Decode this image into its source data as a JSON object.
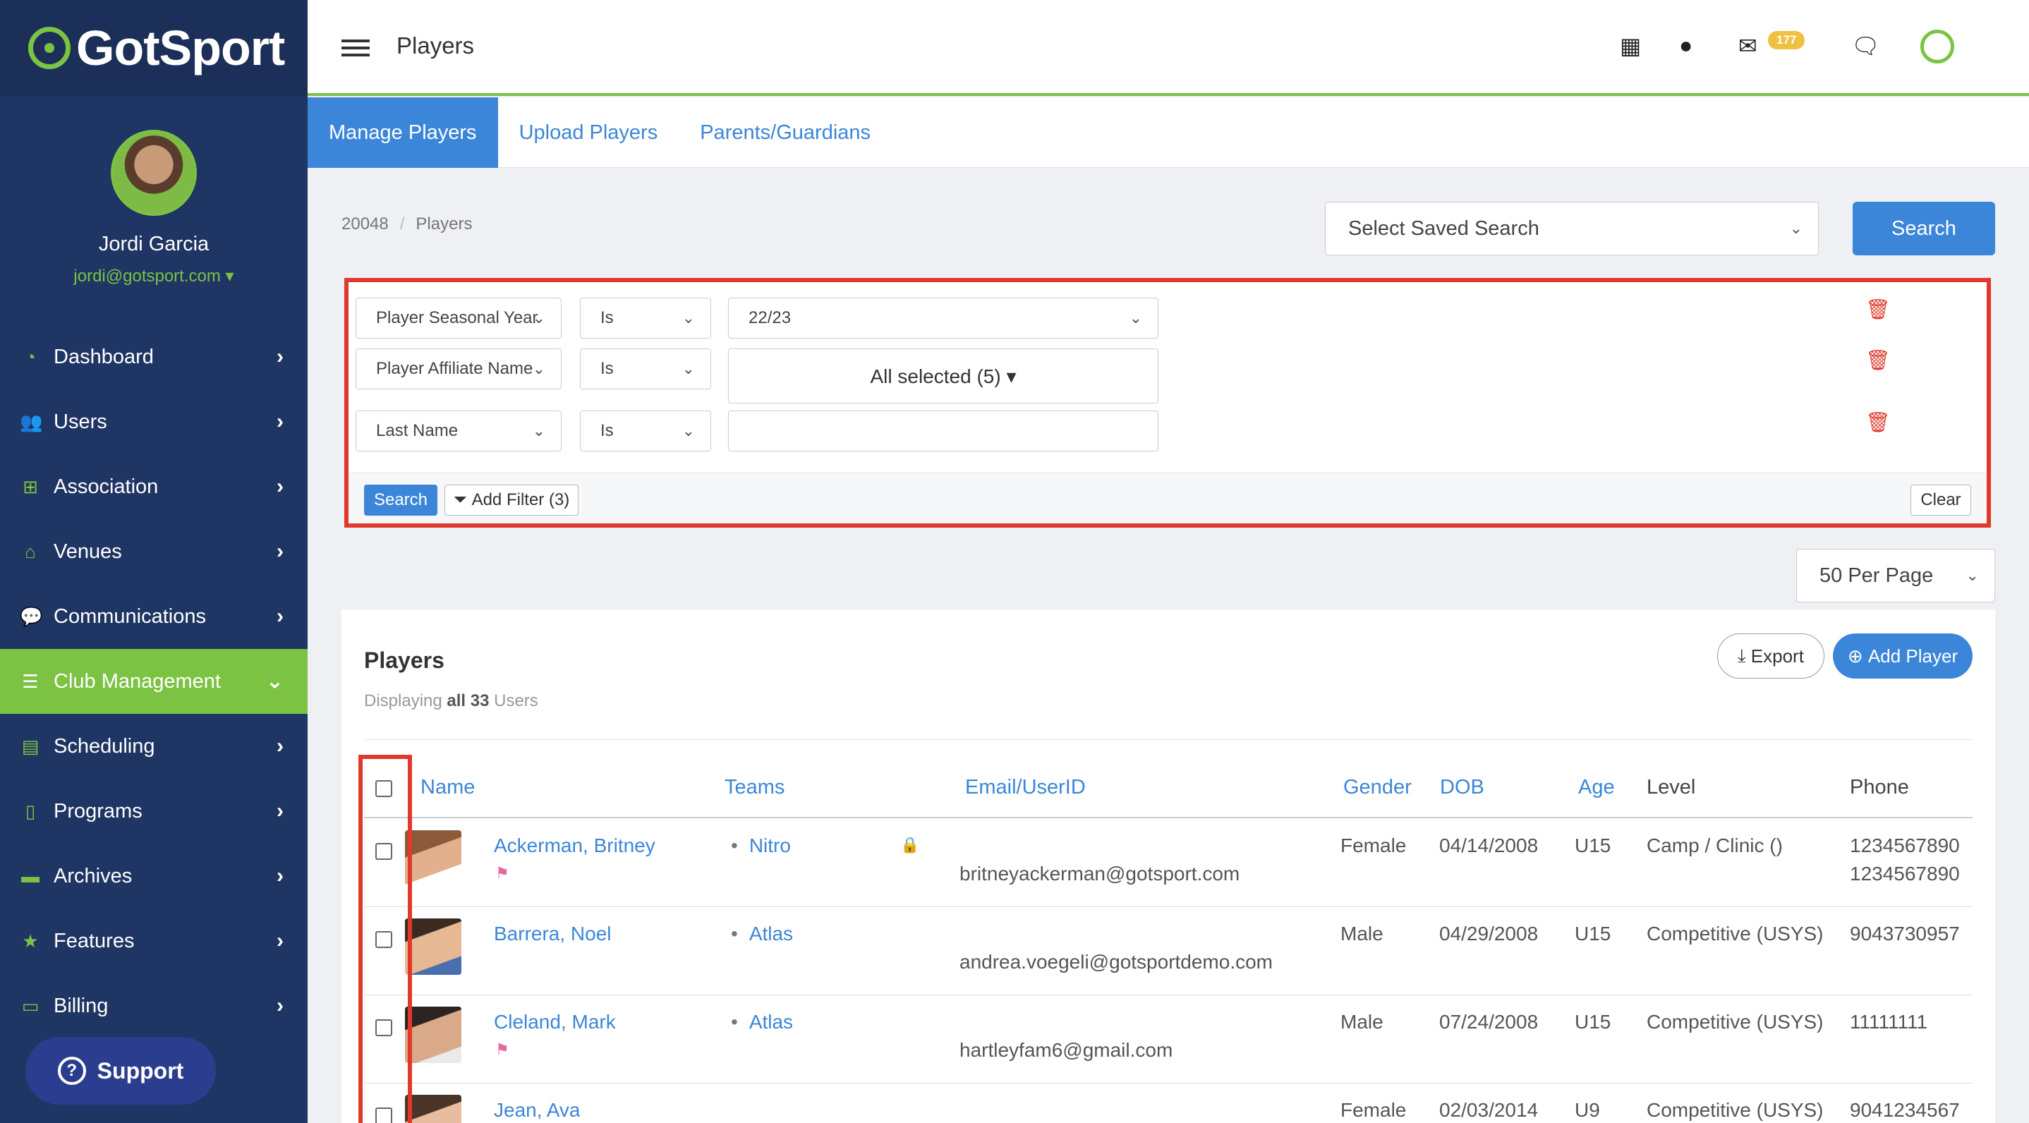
{
  "brand": {
    "logo_prefix": "Got",
    "logo_suffix": "Sport"
  },
  "profile": {
    "name": "Jordi Garcia",
    "email": "jordi@gotsport.com"
  },
  "nav": [
    {
      "label": "Dashboard",
      "icon": "dashboard-icon",
      "active": false
    },
    {
      "label": "Users",
      "icon": "users-icon",
      "active": false
    },
    {
      "label": "Association",
      "icon": "sitemap-icon",
      "active": false
    },
    {
      "label": "Venues",
      "icon": "home-icon",
      "active": false
    },
    {
      "label": "Communications",
      "icon": "comments-icon",
      "active": false
    },
    {
      "label": "Club Management",
      "icon": "list-icon",
      "active": true
    },
    {
      "label": "Scheduling",
      "icon": "calendar-icon",
      "active": false
    },
    {
      "label": "Programs",
      "icon": "document-icon",
      "active": false
    },
    {
      "label": "Archives",
      "icon": "archive-icon",
      "active": false
    },
    {
      "label": "Features",
      "icon": "star-icon",
      "active": false
    },
    {
      "label": "Billing",
      "icon": "credit-card-icon",
      "active": false
    }
  ],
  "support": {
    "label": "Support"
  },
  "topbar": {
    "title": "Players",
    "mail_count": "177"
  },
  "tabs": [
    {
      "label": "Manage Players",
      "active": true
    },
    {
      "label": "Upload Players",
      "active": false
    },
    {
      "label": "Parents/Guardians",
      "active": false
    }
  ],
  "breadcrumb": {
    "id": "20048",
    "page": "Players"
  },
  "saved_search": {
    "placeholder": "Select Saved Search",
    "button": "Search"
  },
  "filters": [
    {
      "field": "Player Seasonal Year",
      "operator": "Is",
      "value": "22/23"
    },
    {
      "field": "Player Affiliate Name",
      "operator": "Is",
      "value": "All selected (5) ▾"
    },
    {
      "field": "Last Name",
      "operator": "Is",
      "value": ""
    }
  ],
  "filter_actions": {
    "search": "Search",
    "add_filter": "Add Filter (3)",
    "clear": "Clear"
  },
  "per_page": "50 Per Page",
  "players_panel": {
    "title": "Players",
    "displaying_prefix": "Displaying",
    "displaying_bold": "all 33",
    "displaying_suffix": "Users",
    "export": "Export",
    "add_player": "Add Player"
  },
  "columns": [
    "Name",
    "Teams",
    "Email/UserID",
    "Gender",
    "DOB",
    "Age",
    "Level",
    "Phone"
  ],
  "rows": [
    {
      "name": "Ackerman, Britney",
      "team": "Nitro",
      "email": "britneyackerman@gotsport.com",
      "gender": "Female",
      "dob": "04/14/2008",
      "age": "U15",
      "level": "Camp / Clinic ()",
      "phone": "1234567890",
      "phone2": "1234567890"
    },
    {
      "name": "Barrera, Noel",
      "team": "Atlas",
      "email": "andrea.voegeli@gotsportdemo.com",
      "gender": "Male",
      "dob": "04/29/2008",
      "age": "U15",
      "level": "Competitive (USYS)",
      "phone": "9043730957",
      "phone2": ""
    },
    {
      "name": "Cleland, Mark",
      "team": "Atlas",
      "email": "hartleyfam6@gmail.com",
      "gender": "Male",
      "dob": "07/24/2008",
      "age": "U15",
      "level": "Competitive (USYS)",
      "phone": "11111111",
      "phone2": ""
    },
    {
      "name": "Jean, Ava",
      "team": "",
      "email": "",
      "gender": "Female",
      "dob": "02/03/2014",
      "age": "U9",
      "level": "Competitive (USYS)",
      "phone": "9041234567",
      "phone2": ""
    }
  ]
}
